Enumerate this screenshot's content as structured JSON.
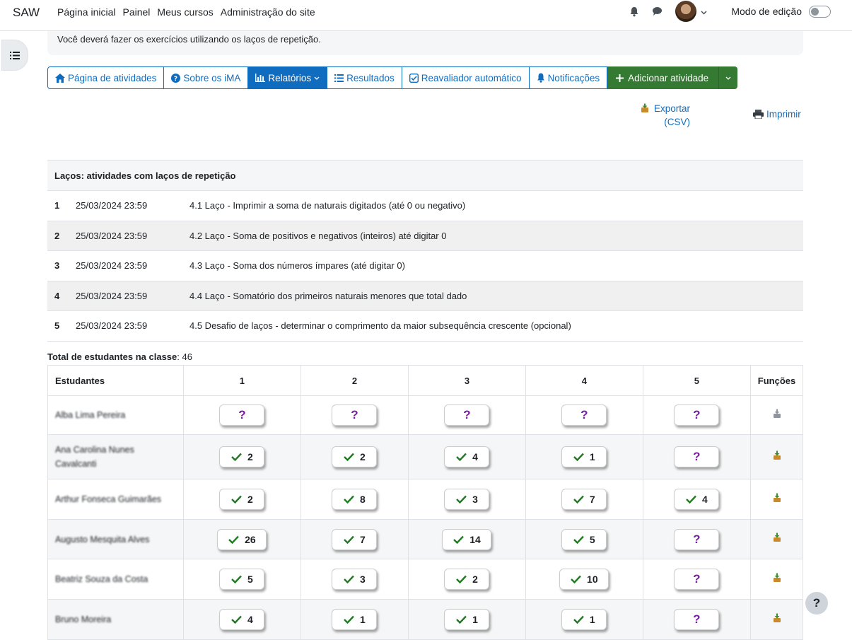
{
  "navbar": {
    "brand": "SAW",
    "links": [
      "Página inicial",
      "Painel",
      "Meus cursos",
      "Administração do site"
    ],
    "edit_mode_label": "Modo de edição"
  },
  "intro": {
    "text": "Você deverá fazer os exercícios utilizando os laços de repetição."
  },
  "tabs": [
    {
      "label": "Página de atividades",
      "icon": "home-icon"
    },
    {
      "label": "Sobre os iMA",
      "icon": "question-circle-icon"
    },
    {
      "label": "Relatórios",
      "icon": "bar-chart-icon",
      "active": true
    },
    {
      "label": "Resultados",
      "icon": "list-icon"
    },
    {
      "label": "Reavaliador automático",
      "icon": "check-square-icon"
    },
    {
      "label": "Notificações",
      "icon": "bell-icon"
    }
  ],
  "add_button": {
    "label": "Adicionar atividade"
  },
  "export": {
    "label": "Exportar (CSV)"
  },
  "print": {
    "label": "Imprimir"
  },
  "activities": {
    "header": "Laços: atividades com laços de repetição",
    "rows": [
      {
        "num": "1",
        "date": "25/03/2024 23:59",
        "title": "4.1 Laço - Imprimir a soma de naturais digitados (até 0 ou negativo)"
      },
      {
        "num": "2",
        "date": "25/03/2024 23:59",
        "title": "4.2 Laço - Soma de positivos e negativos (inteiros) até digitar 0"
      },
      {
        "num": "3",
        "date": "25/03/2024 23:59",
        "title": "4.3 Laço - Soma dos números ímpares (até digitar 0)"
      },
      {
        "num": "4",
        "date": "25/03/2024 23:59",
        "title": "4.4 Laço - Somatório dos primeiros naturais menores que total dado"
      },
      {
        "num": "5",
        "date": "25/03/2024 23:59",
        "title": "4.5 Desafio de laços - determinar o comprimento da maior subsequência crescente (opcional)"
      }
    ]
  },
  "total": {
    "label": "Total de estudantes na classe",
    "value": ": 46"
  },
  "grid": {
    "headers": [
      "Estudantes",
      "1",
      "2",
      "3",
      "4",
      "5",
      "Funções"
    ],
    "students": [
      {
        "name": "Alba Lima Pereira",
        "cells": [
          "?",
          "?",
          "?",
          "?",
          "?"
        ],
        "fn": "inactive"
      },
      {
        "name": "Ana Carolina Nunes Cavalcanti",
        "cells": [
          "2",
          "2",
          "4",
          "1",
          "?"
        ],
        "fn": "active"
      },
      {
        "name": "Arthur Fonseca Guimarães",
        "cells": [
          "2",
          "8",
          "3",
          "7",
          "4"
        ],
        "fn": "active"
      },
      {
        "name": "Augusto Mesquita Alves",
        "cells": [
          "26",
          "7",
          "14",
          "5",
          "?"
        ],
        "fn": "active"
      },
      {
        "name": "Beatriz Souza da Costa",
        "cells": [
          "5",
          "3",
          "2",
          "10",
          "?"
        ],
        "fn": "active"
      },
      {
        "name": "Bruno Moreira",
        "cells": [
          "4",
          "1",
          "1",
          "1",
          "?"
        ],
        "fn": "active"
      }
    ]
  },
  "help": {
    "label": "?"
  },
  "colors": {
    "primary": "#0f6cbf",
    "success": "#357a32",
    "question": "#7a1ea1",
    "check": "#1f7a22"
  }
}
